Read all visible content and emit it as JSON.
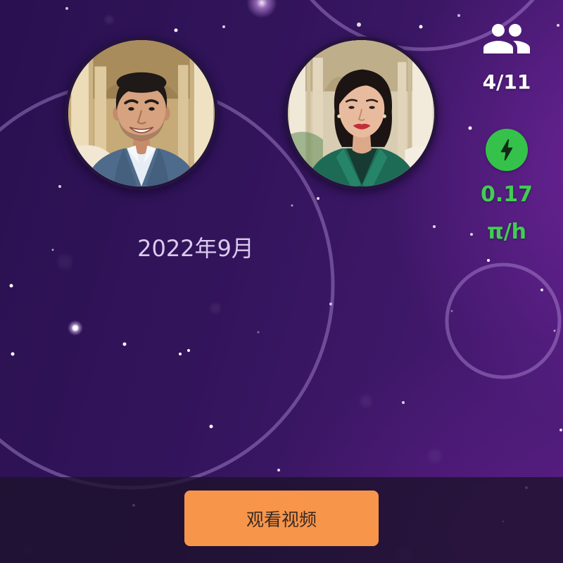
{
  "screen": {
    "colors": {
      "background": "#34145e",
      "ring": "#b996e1",
      "mining_green": "#3fcf50",
      "button_orange": "#f7954b",
      "button_text": "#3a2a22"
    }
  },
  "team": {
    "icon": "people-icon",
    "count": "4/11"
  },
  "mining": {
    "icon": "lightning-bolt-icon",
    "rate": "0.17",
    "unit": "π/h"
  },
  "timeline": {
    "date_label": "2022年9月"
  },
  "actions": {
    "watch_video_label": "观看视频"
  }
}
